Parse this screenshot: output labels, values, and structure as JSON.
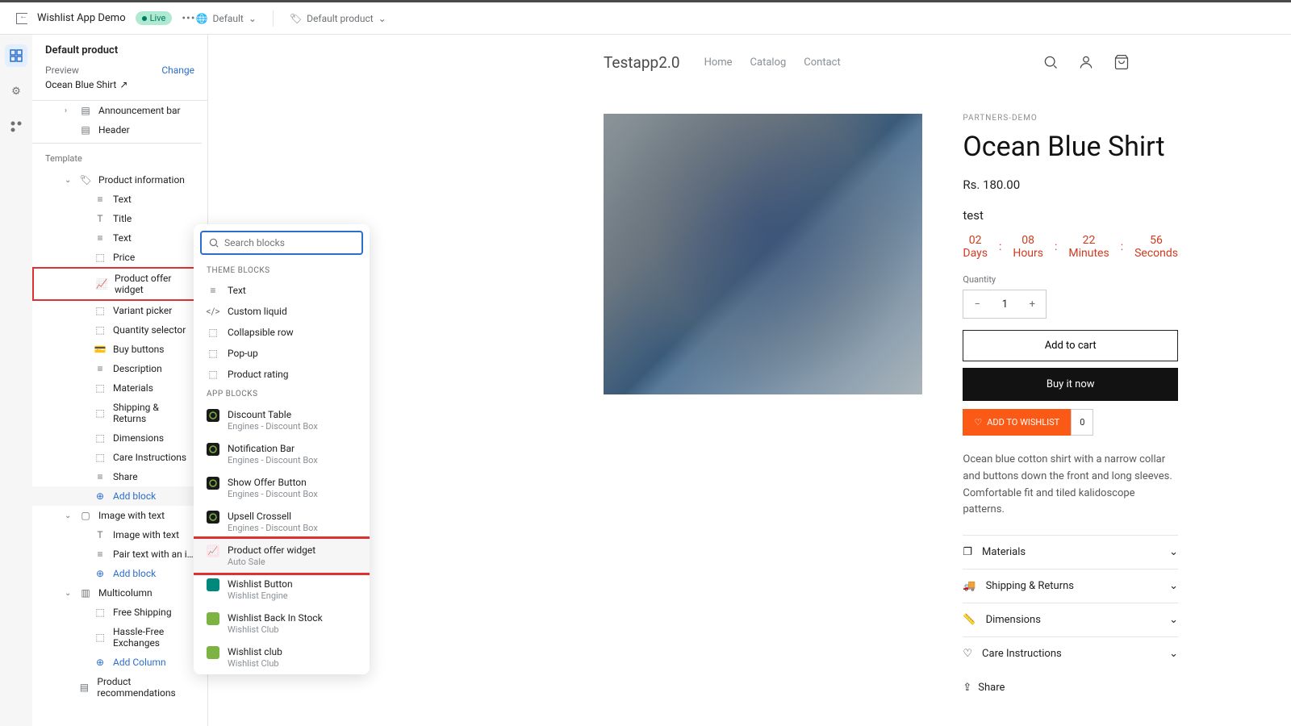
{
  "header": {
    "app_name": "Wishlist App Demo",
    "status": "Live",
    "lang": "Default",
    "product": "Default product"
  },
  "sidebar": {
    "title": "Default product",
    "preview_label": "Preview",
    "change": "Change",
    "preview_product": "Ocean Blue Shirt",
    "top": [
      {
        "label": "Announcement bar"
      },
      {
        "label": "Header"
      }
    ],
    "template_label": "Template",
    "product_info": {
      "label": "Product information",
      "items": [
        "Text",
        "Title",
        "Text",
        "Price",
        "Product offer widget",
        "Variant picker",
        "Quantity selector",
        "Buy buttons",
        "Description",
        "Materials",
        "Shipping & Returns",
        "Dimensions",
        "Care Instructions",
        "Share"
      ],
      "add": "Add block"
    },
    "image_text": {
      "label": "Image with text",
      "items": [
        "Image with text",
        "Pair text with an image to fo..."
      ],
      "add": "Add block"
    },
    "multicolumn": {
      "label": "Multicolumn",
      "items": [
        "Free Shipping",
        "Hassle-Free Exchanges"
      ],
      "add": "Add Column"
    },
    "product_rec": "Product recommendations"
  },
  "popover": {
    "placeholder": "Search blocks",
    "theme_label": "THEME BLOCKS",
    "theme": [
      "Text",
      "Custom liquid",
      "Collapsible row",
      "Pop-up",
      "Product rating"
    ],
    "app_label": "APP BLOCKS",
    "apps": [
      {
        "name": "Discount Table",
        "sub": "Engines - Discount Box"
      },
      {
        "name": "Notification Bar",
        "sub": "Engines - Discount Box"
      },
      {
        "name": "Show Offer Button",
        "sub": "Engines - Discount Box"
      },
      {
        "name": "Upsell Crossell",
        "sub": "Engines - Discount Box"
      },
      {
        "name": "Product offer widget",
        "sub": "Auto Sale"
      },
      {
        "name": "Wishlist Button",
        "sub": "Wishlist Engine"
      },
      {
        "name": "Wishlist Back In Stock",
        "sub": "Wishlist Club"
      },
      {
        "name": "Wishlist club",
        "sub": "Wishlist Club"
      }
    ]
  },
  "store": {
    "logo": "Testapp2.0",
    "nav": [
      "Home",
      "Catalog",
      "Contact"
    ],
    "brand": "PARTNERS-DEMO",
    "title": "Ocean Blue Shirt",
    "price": "Rs. 180.00",
    "test": "test",
    "countdown": [
      {
        "v": "02",
        "l": "Days"
      },
      {
        "v": "08",
        "l": "Hours"
      },
      {
        "v": "22",
        "l": "Minutes"
      },
      {
        "v": "56",
        "l": "Seconds"
      }
    ],
    "qty_label": "Quantity",
    "qty": "1",
    "add_cart": "Add to cart",
    "buy": "Buy it now",
    "wishlist": "ADD TO WISHLIST",
    "wishlist_count": "0",
    "desc": "Ocean blue cotton shirt with a narrow collar and buttons down the front and long sleeves. Comfortable fit and tiled kalidoscope patterns.",
    "accordions": [
      "Materials",
      "Shipping & Returns",
      "Dimensions",
      "Care Instructions"
    ],
    "share": "Share"
  },
  "colors": {
    "accent": "#2c6ecb",
    "highlight": "#e03131"
  }
}
